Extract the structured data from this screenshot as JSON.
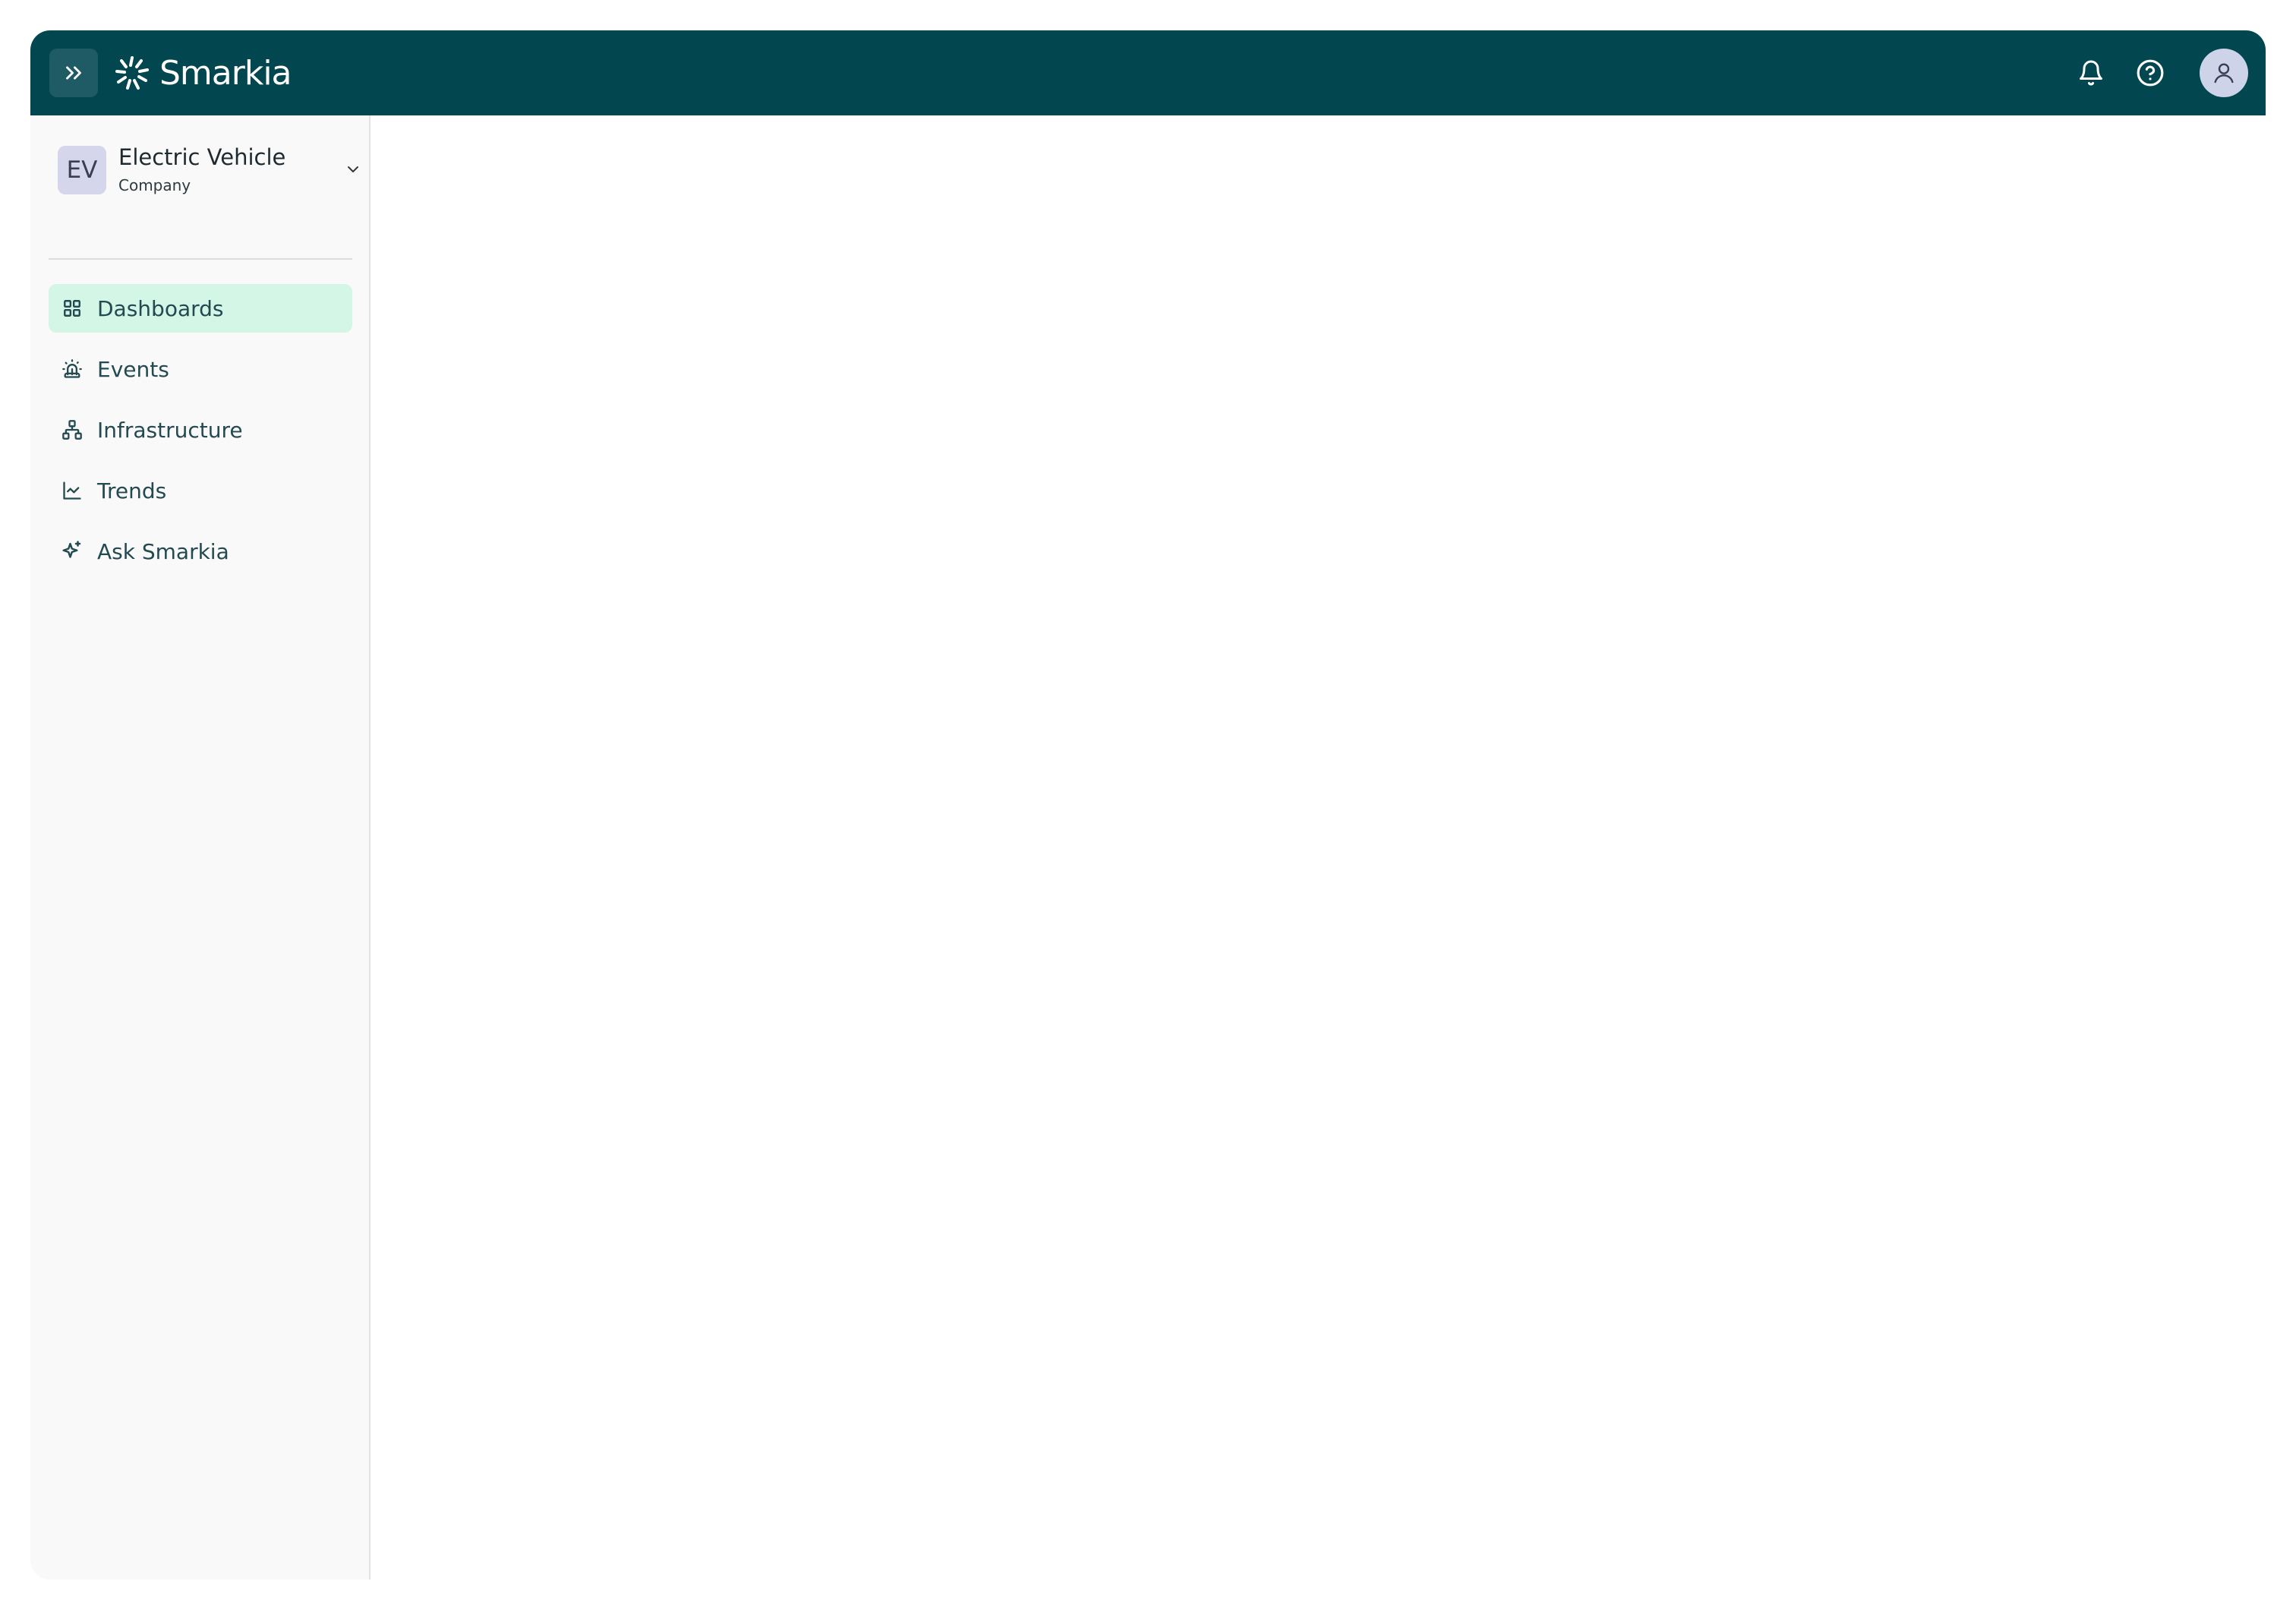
{
  "header": {
    "brand_name": "Smarkia",
    "colors": {
      "bar": "#024650",
      "logo": "#ffffff"
    },
    "icons": [
      "chevrons-right-icon",
      "smarkia-logo-icon",
      "bell-icon",
      "help-circle-icon",
      "user-icon"
    ]
  },
  "sidebar": {
    "organization": {
      "initials": "EV",
      "name": "Electric Vehicle",
      "type": "Company"
    },
    "items": [
      {
        "label": "Dashboards",
        "icon": "grid-icon",
        "active": true
      },
      {
        "label": "Events",
        "icon": "siren-icon",
        "active": false
      },
      {
        "label": "Infrastructure",
        "icon": "network-icon",
        "active": false
      },
      {
        "label": "Trends",
        "icon": "line-chart-icon",
        "active": false
      },
      {
        "label": "Ask Smarkia",
        "icon": "sparkles-icon",
        "active": false
      }
    ],
    "colors": {
      "active_bg": "#d3f6e6",
      "text": "#234a50"
    }
  }
}
